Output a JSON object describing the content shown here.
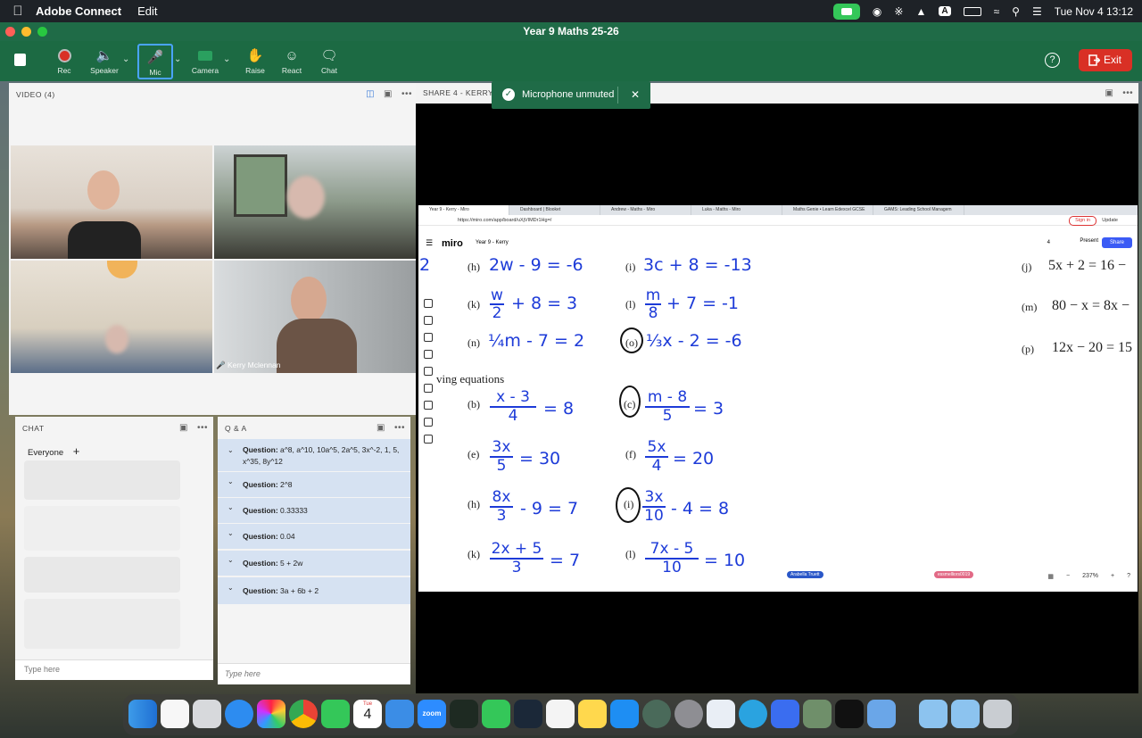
{
  "menubar": {
    "app_name": "Adobe Connect",
    "menu_edit": "Edit",
    "input_badge": "A",
    "datetime": "Tue Nov 4  13:12"
  },
  "window": {
    "title": "Year 9 Maths 25-26"
  },
  "toolbar": {
    "rec": "Rec",
    "speaker": "Speaker",
    "mic": "Mic",
    "camera": "Camera",
    "raise": "Raise",
    "react": "React",
    "chat": "Chat",
    "exit": "Exit",
    "help": "?"
  },
  "toast": {
    "message": "Microphone unmuted",
    "close": "✕"
  },
  "video_pod": {
    "title": "VIDEO (4)",
    "speaker_name": "Kerry Mclennan"
  },
  "share_pod": {
    "title": "SHARE 4 - KERRY M"
  },
  "chat_pod": {
    "title": "CHAT",
    "audience": "Everyone",
    "input_placeholder": "Type here"
  },
  "qa_pod": {
    "title": "Q & A",
    "prefix": "Question:",
    "questions": [
      "a^8, a^10, 10a^5, 2a^5, 3x^-2, 1, 5, x^35, 8y^12",
      "2^8",
      "0.33333",
      "0.04",
      "5 + 2w",
      "3a + 6b + 2"
    ],
    "input_placeholder": "Type here"
  },
  "browser": {
    "tabs": [
      "Year 9 - Kerry - Miro",
      "Dashboard | Blooket",
      "Andrew - Maths - Miro",
      "Luka - Maths - Miro",
      "Maths Genie • Learn Edexcel GCSE",
      "GAMS: Leading School Managem"
    ],
    "url": "https://miro.com/app/board/uXjVIMDr1Hg=/",
    "sign_in": "Sign in",
    "update": "Update"
  },
  "miro": {
    "logo": "miro",
    "board": "Year 9 - Kerry",
    "present": "Present",
    "share": "Share",
    "zoom": "237%",
    "collaborator_count": "4",
    "cursor_1": "Arabella Truett",
    "cursor_2": "essmelliors0019",
    "section_heading": "ving equations",
    "row1": [
      {
        "label": "(h)",
        "eq": "2w - 9 = -6"
      },
      {
        "label": "(i)",
        "eq": "3c + 8 = -13"
      },
      {
        "label": "(j)",
        "eq": "5x + 2 = 16 −"
      }
    ],
    "row2": [
      {
        "label": "(k)",
        "num": "w",
        "den": "2",
        "rest": "+ 8 = 3"
      },
      {
        "label": "(l)",
        "num": "m",
        "den": "8",
        "rest": "+ 7 = -1"
      },
      {
        "label": "(m)",
        "eq": "80 − x = 8x −"
      }
    ],
    "row3": [
      {
        "label": "(n)",
        "eq": "¼m - 7 = 2"
      },
      {
        "label": "(o)",
        "eq": "⅓x - 2 = -6"
      },
      {
        "label": "(p)",
        "eq": "12x − 20 = 15"
      }
    ],
    "row4": [
      {
        "label": "(b)",
        "num": "x - 3",
        "den": "4",
        "rest": "= 8"
      },
      {
        "label": "(c)",
        "num": "m - 8",
        "den": "5",
        "rest": "= 3"
      }
    ],
    "row5": [
      {
        "label": "(e)",
        "num": "3x",
        "den": "5",
        "rest": "= 30"
      },
      {
        "label": "(f)",
        "num": "5x",
        "den": "4",
        "rest": "= 20"
      }
    ],
    "row6": [
      {
        "label": "(h)",
        "num": "8x",
        "den": "3",
        "rest": "- 9 = 7"
      },
      {
        "label": "(i)",
        "num": "3x",
        "den": "10",
        "rest": "- 4 = 8"
      }
    ],
    "row7": [
      {
        "label": "(k)",
        "num": "2x + 5",
        "den": "3",
        "rest": "= 7"
      },
      {
        "label": "(l)",
        "num": "7x - 5",
        "den": "10",
        "rest": "= 10"
      }
    ],
    "left_partial": "2"
  },
  "dock": {
    "calendar_month": "Tue",
    "calendar_day": "4",
    "zoom_label": "zoom"
  },
  "colors": {
    "connect_green": "#1c6a43",
    "exit_red": "#d93025",
    "miro_blue": "#1d3bd8",
    "qa_blue": "#d6e2f2"
  }
}
